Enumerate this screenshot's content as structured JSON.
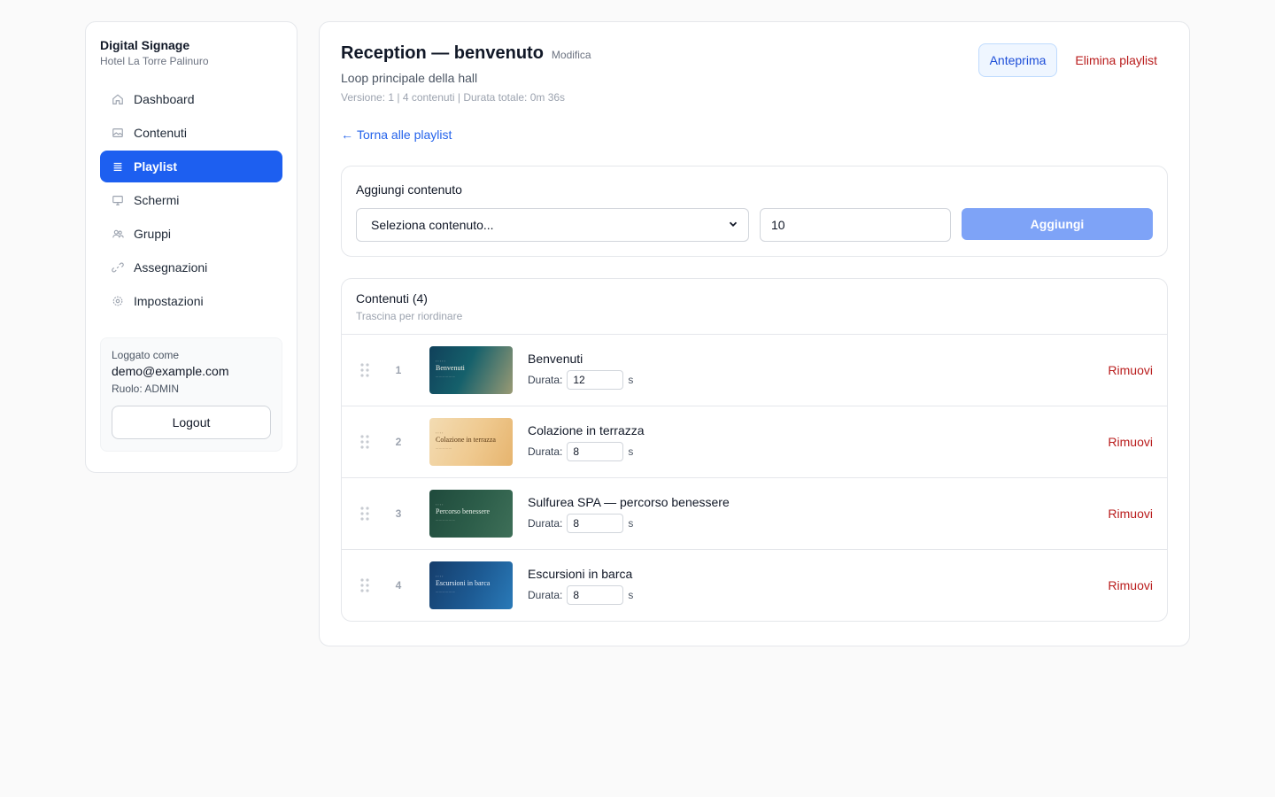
{
  "sidebar": {
    "brand_title": "Digital Signage",
    "brand_subtitle": "Hotel La Torre Palinuro",
    "items": [
      {
        "label": "Dashboard",
        "icon": "home-icon"
      },
      {
        "label": "Contenuti",
        "icon": "image-icon"
      },
      {
        "label": "Playlist",
        "icon": "list-icon"
      },
      {
        "label": "Schermi",
        "icon": "monitor-icon"
      },
      {
        "label": "Gruppi",
        "icon": "users-icon"
      },
      {
        "label": "Assegnazioni",
        "icon": "link-icon"
      },
      {
        "label": "Impostazioni",
        "icon": "gear-icon"
      }
    ],
    "active_item": "Playlist",
    "user": {
      "logged_as_label": "Loggato come",
      "email": "demo@example.com",
      "role": "Ruolo: ADMIN",
      "logout_label": "Logout"
    }
  },
  "header": {
    "title": "Reception — benvenuto",
    "edit_label": "Modifica",
    "subtitle": "Loop principale della hall",
    "meta": "Versione: 1 | 4 contenuti | Durata totale: 0m 36s",
    "preview_label": "Anteprima",
    "delete_label": "Elimina playlist",
    "back_label": "Torna alle playlist"
  },
  "add_content": {
    "title": "Aggiungi contenuto",
    "select_value": "Seleziona contenuto...",
    "duration_value": "10",
    "add_label": "Aggiungi"
  },
  "contents": {
    "title": "Contenuti (4)",
    "hint": "Trascina per riordinare",
    "duration_label": "Durata:",
    "unit": "s",
    "remove_label": "Rimuovi",
    "items": [
      {
        "index": "1",
        "name": "Benvenuti",
        "duration": "12",
        "thumb_title": "Benvenuti"
      },
      {
        "index": "2",
        "name": "Colazione in terrazza",
        "duration": "8",
        "thumb_title": "Colazione in terrazza"
      },
      {
        "index": "3",
        "name": "Sulfurea SPA — percorso benessere",
        "duration": "8",
        "thumb_title": "Percorso benessere"
      },
      {
        "index": "4",
        "name": "Escursioni in barca",
        "duration": "8",
        "thumb_title": "Escursioni in barca"
      }
    ]
  },
  "colors": {
    "accent": "#1d5ff0",
    "danger": "#b91c1c",
    "link": "#2563eb",
    "add_button": "#7ea3f7"
  }
}
